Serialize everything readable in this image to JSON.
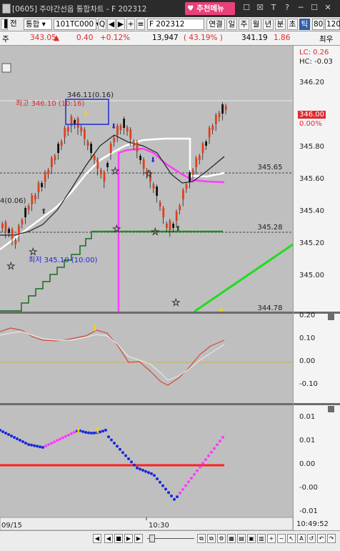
{
  "window": {
    "title": "[0605] 주야간선옵 통합차트 - F 202312",
    "recommend_menu": "추천메뉴",
    "buttons": [
      "☐",
      "☒",
      "T",
      "?",
      "─",
      "☐",
      "✕"
    ]
  },
  "toolbar": {
    "row_label": "전",
    "mode": "통합",
    "code": "101TC000",
    "name": "F 202312",
    "link_label": "연결",
    "periods": [
      "일",
      "주",
      "월",
      "년",
      "분",
      "초",
      "틱"
    ],
    "active_period": "틱",
    "count": "80",
    "extra": "120"
  },
  "quote": {
    "label": "주",
    "price": "343.05",
    "change": "0.40",
    "change_pct": "+0.12%",
    "volume": "13,947",
    "volume_pct": "( 43.19% )",
    "other_price": "341.19",
    "other_change": "1.86",
    "max_label": "최우"
  },
  "chart": {
    "main_labels": {
      "high": "최고 346.10 (10:16)",
      "high_box": "346.11(0.16)",
      "low": "최저 345.10 (10:00)",
      "left_cut": "4(0.06)",
      "line_345_65": "345.65",
      "line_345_28": "345.28",
      "bottom_value": "344.78",
      "lc": "LC: 0.26",
      "hc": "HC: -0.03",
      "current": "346.00",
      "current_pct": "0.00%"
    },
    "main_axis": [
      "346.20",
      "346.00",
      "345.80",
      "345.60",
      "345.40",
      "345.20",
      "345.00"
    ],
    "mid_axis": [
      "0.20",
      "0.10",
      "0.00",
      "-0.10"
    ],
    "bottom_axis": [
      "0.01",
      "0.01",
      "0.00",
      "-0.00",
      "-0.01"
    ],
    "time_labels": [
      "09/15",
      "10:30",
      "10:49:52"
    ],
    "colors": {
      "up": "#e0401f",
      "panel": "#bfbfbf",
      "magenta": "#ff3cff",
      "green": "#1fdc1f",
      "blue": "#1a2ad8",
      "red": "#ff2020"
    }
  }
}
